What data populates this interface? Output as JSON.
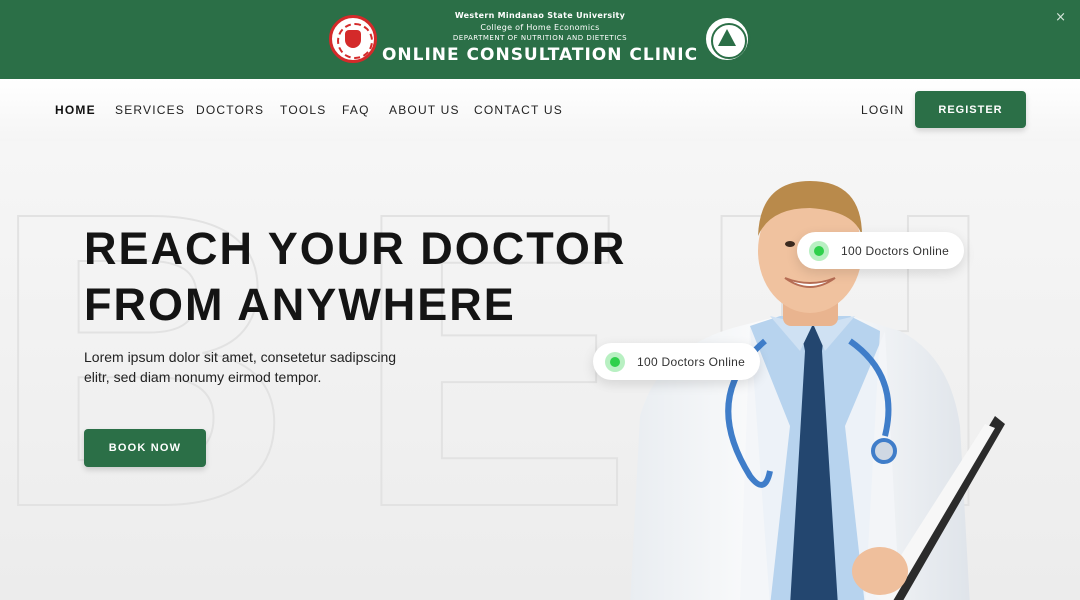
{
  "banner": {
    "university": "Western Mindanao State University",
    "college": "College of Home Economics",
    "department": "DEPARTMENT OF NUTRITION AND DIETETICS",
    "title": "ONLINE CONSULTATION CLINIC",
    "close_glyph": "×"
  },
  "nav": {
    "items": [
      "HOME",
      "SERVICES",
      "DOCTORS",
      "TOOLS",
      "FAQ",
      "ABOUT US",
      "CONTACT US"
    ],
    "login": "LOGIN",
    "register": "REGISTER"
  },
  "hero": {
    "headline_line1": "REACH YOUR DOCTOR",
    "headline_line2": "FROM ANYWHERE",
    "sub_line1": "Lorem ipsum dolor sit amet, consetetur sadipscing",
    "sub_line2": "elitr, sed diam nonumy eirmod tempor.",
    "book_button": "BOOK NOW",
    "status_pill_1": "100 Doctors Online",
    "status_pill_2": "100 Doctors Online"
  },
  "colors": {
    "brand_green": "#2b6f47",
    "online_dot": "#2ed04b"
  }
}
